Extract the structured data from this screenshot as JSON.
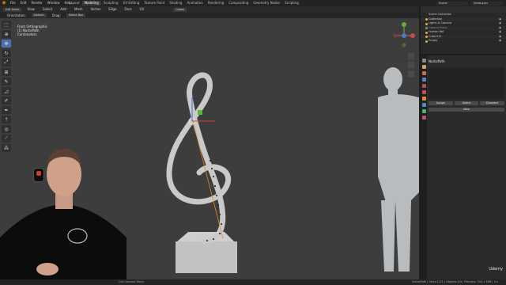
{
  "topbar": {
    "menus": [
      "File",
      "Edit",
      "Render",
      "Window",
      "Help"
    ],
    "workspaces": [
      "Layout",
      "Modeling",
      "Sculpting",
      "UV Editing",
      "Texture Paint",
      "Shading",
      "Animation",
      "Rendering",
      "Compositing",
      "Geometry Nodes",
      "Scripting"
    ],
    "active_workspace": "Modeling",
    "scene": "Scene",
    "view_layer": "ViewLayer"
  },
  "header": {
    "mode": "Edit Mode",
    "menus": [
      "View",
      "Select",
      "Add",
      "Mesh",
      "Vertex",
      "Edge",
      "Face",
      "UV"
    ],
    "transform_orientation": "Global",
    "row2": [
      "Orientation:",
      "Default",
      "Drag:",
      "Select Box"
    ]
  },
  "viewport": {
    "info_line1": "Front Orthographic",
    "info_line2": "(1) NurbsPath",
    "info_line3": "Centimeters"
  },
  "outliner": {
    "items": [
      {
        "label": "Scene Collection",
        "color": "#cccccc"
      },
      {
        "label": "Collection",
        "color": "#e0a84a"
      },
      {
        "label": "Lights & Camera",
        "color": "#e0a84a"
      },
      {
        "label": "Ground Plane",
        "color": "#8a8a8a"
      },
      {
        "label": "Human Ref",
        "color": "#e0a84a"
      },
      {
        "label": "Cube.011",
        "color": "#e0a84a"
      },
      {
        "label": "Empty",
        "color": "#e0a84a"
      }
    ]
  },
  "properties": {
    "object_name": "NurbsPath",
    "buttons": [
      "Assign",
      "Select",
      "Deselect"
    ],
    "new_label": "New"
  },
  "statusbar": {
    "left": "Call Context Menu",
    "right": "NurbsPath | Verts:1/13 | Objects:1/4 | Memory: 554.1 MiB | 3.x"
  },
  "watermark": "Udemy",
  "colors": {
    "viewport_bg": "#3d3d3d",
    "accent": "#4772b3",
    "brand": "#e87d0d"
  }
}
